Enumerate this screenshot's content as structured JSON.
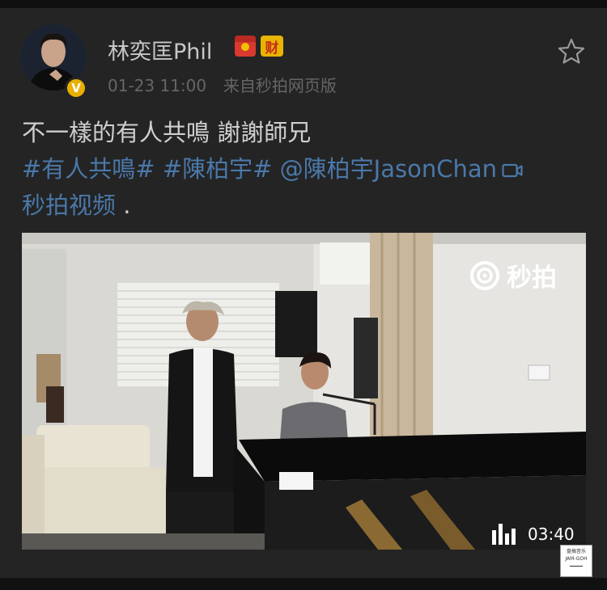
{
  "post": {
    "username": "林奕匡Phil",
    "badge_text": "财",
    "timestamp": "01-23 11:00",
    "source": "来自秒拍网页版",
    "text": "不一樣的有人共鳴 謝謝師兄",
    "hashtag1": "#有人共鳴#",
    "hashtag2": "#陳柏宇#",
    "mention": "@陳柏宇JasonChan",
    "video_link": "秒拍视频",
    "trailing": "."
  },
  "video": {
    "watermark": "秒拍",
    "duration": "03:40"
  },
  "stamp": {
    "line1": "盘搞音乐",
    "line2": "JAM-GOH"
  },
  "icons": {
    "avatar": "avatar-photo",
    "verified": "verified-badge-icon",
    "star": "star-icon",
    "camera": "video-camera-icon"
  }
}
